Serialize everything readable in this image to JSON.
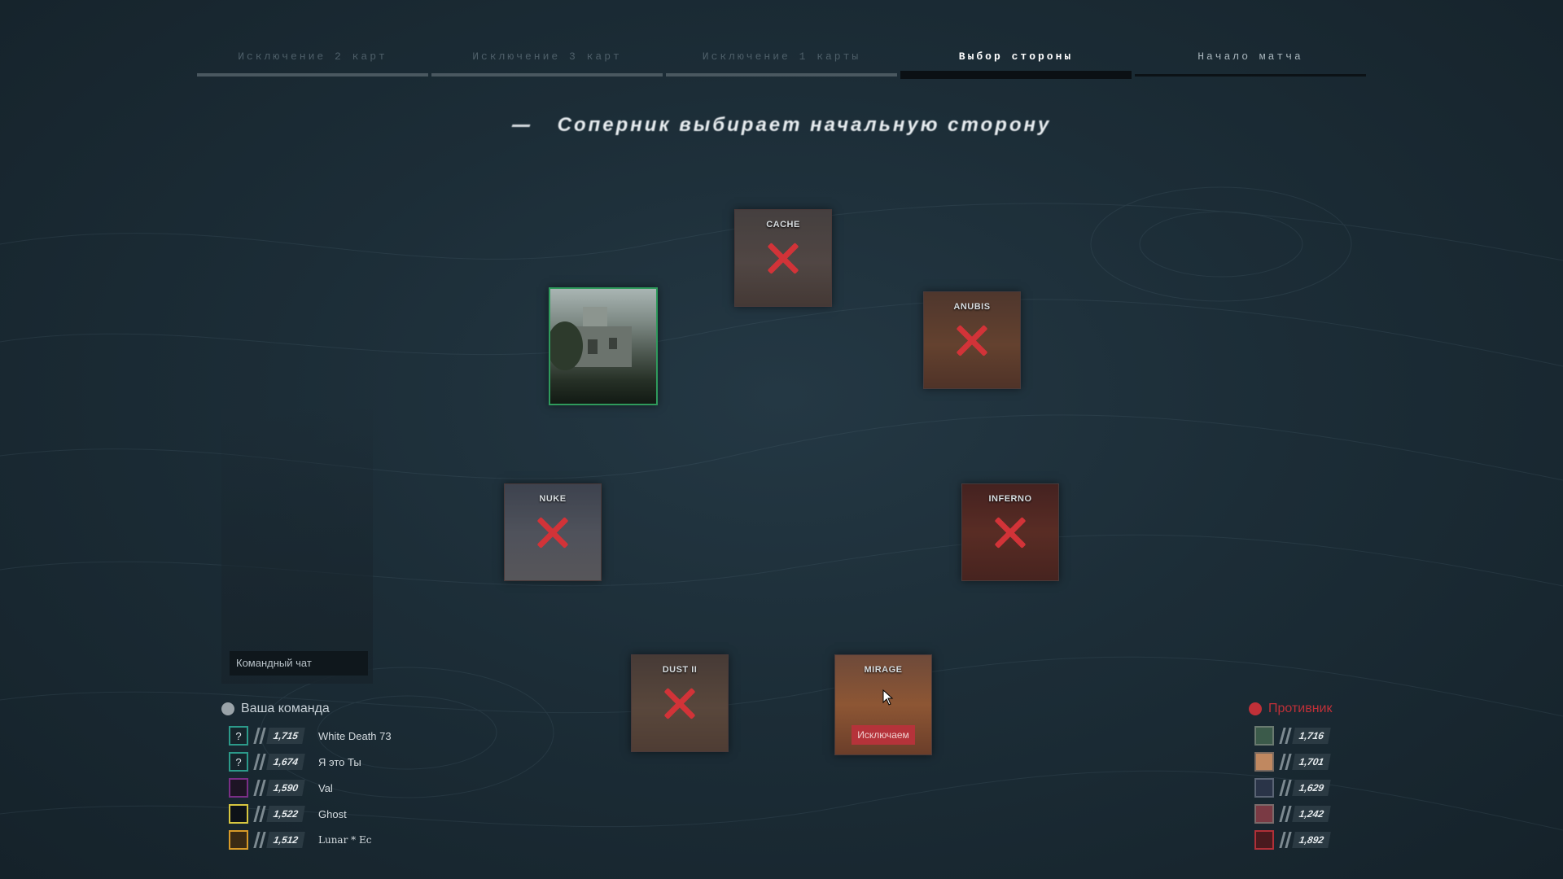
{
  "stages": [
    {
      "label": "Исключение 2 карт",
      "state": "done"
    },
    {
      "label": "Исключение 3 карт",
      "state": "done"
    },
    {
      "label": "Исключение 1 карты",
      "state": "done"
    },
    {
      "label": "Выбор стороны",
      "state": "current"
    },
    {
      "label": "Начало матча",
      "state": "next"
    }
  ],
  "headline": "Соперник выбирает начальную сторону",
  "maps": {
    "cache": {
      "label": "CACHE",
      "banned": true
    },
    "anubis": {
      "label": "ANUBIS",
      "banned": true
    },
    "nuke": {
      "label": "NUKE",
      "banned": true
    },
    "inferno": {
      "label": "INFERNO",
      "banned": true
    },
    "dust2": {
      "label": "DUST II",
      "banned": true
    },
    "mirage": {
      "label": "MIRAGE",
      "banned": false,
      "action_label": "Исключаем"
    },
    "picked": {
      "label": "",
      "selected": true
    }
  },
  "chat": {
    "placeholder": "Командный чат"
  },
  "my_team": {
    "title": "Ваша команда",
    "players": [
      {
        "elo": "1,715",
        "name": "White Death 73",
        "avatar": "?",
        "border": "#2c9a8a"
      },
      {
        "elo": "1,674",
        "name": "Я это Ты",
        "avatar": "?",
        "border": "#2c9a8a"
      },
      {
        "elo": "1,590",
        "name": "Val",
        "avatar": "",
        "border": "#7a2e86"
      },
      {
        "elo": "1,522",
        "name": "Ghost",
        "avatar": "",
        "border": "#d7c640"
      },
      {
        "elo": "1,512",
        "name": "Lunar * Ec",
        "avatar": "",
        "border": "#d89a28"
      }
    ]
  },
  "enemy_team": {
    "title": "Противник",
    "color": "#c03038",
    "players": [
      {
        "elo": "1,716"
      },
      {
        "elo": "1,701"
      },
      {
        "elo": "1,629"
      },
      {
        "elo": "1,242"
      },
      {
        "elo": "1,892"
      }
    ]
  }
}
